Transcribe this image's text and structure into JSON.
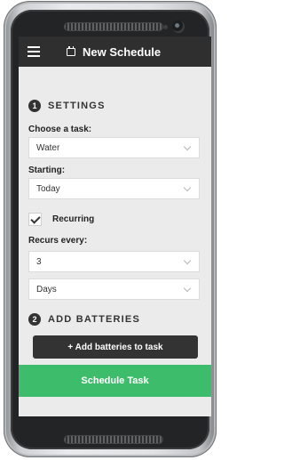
{
  "app": {
    "title": "New Schedule"
  },
  "settings": {
    "step": "1",
    "title": "SETTINGS",
    "task": {
      "label": "Choose a task:",
      "value": "Water"
    },
    "starting": {
      "label": "Starting:",
      "value": "Today"
    },
    "recurring": {
      "label": "Recurring",
      "checked": true
    },
    "recurs": {
      "label": "Recurs every:",
      "count": "3",
      "unit": "Days"
    }
  },
  "batteries": {
    "step": "2",
    "title": "ADD BATTERIES",
    "button_label": "+ Add batteries to task"
  },
  "footer": {
    "schedule_label": "Schedule Task"
  },
  "colors": {
    "appbar": "#2f2f2f",
    "accent_green": "#3dbd6b",
    "background": "#ebebeb"
  }
}
